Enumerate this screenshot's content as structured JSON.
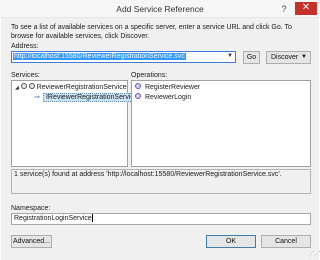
{
  "window": {
    "title": "Add Service Reference",
    "help_label": "?",
    "close_label": "✕"
  },
  "instructions": "To see a list of available services on a specific server, enter a service URL and click Go. To browse for available services, click Discover.",
  "address": {
    "label": "Address:",
    "value": "http://localhost:15580/ReviewerRegistrationService.svc"
  },
  "buttons": {
    "go": "Go",
    "discover": "Discover",
    "advanced": "Advanced...",
    "ok": "OK",
    "cancel": "Cancel"
  },
  "services": {
    "label": "Services:",
    "items": [
      {
        "label": "ReviewerRegistrationService",
        "icon": "service-icon",
        "expanded": true
      },
      {
        "label": "IReviewerRegistrationService",
        "icon": "interface-icon",
        "selected": true
      }
    ]
  },
  "operations": {
    "label": "Operations:",
    "items": [
      {
        "label": "RegisterReviewer",
        "icon": "operation-icon"
      },
      {
        "label": "ReviewerLogin",
        "icon": "operation-icon"
      }
    ]
  },
  "status": "1 service(s) found at address 'http://localhost:15580/ReviewerRegistrationService.svc'.",
  "namespace": {
    "label": "Namespace:",
    "value": "RegistrationLoginService"
  },
  "colors": {
    "selection": "#3399ff",
    "close_button": "#c7312b",
    "dialog_background": "#f0f0f0"
  }
}
